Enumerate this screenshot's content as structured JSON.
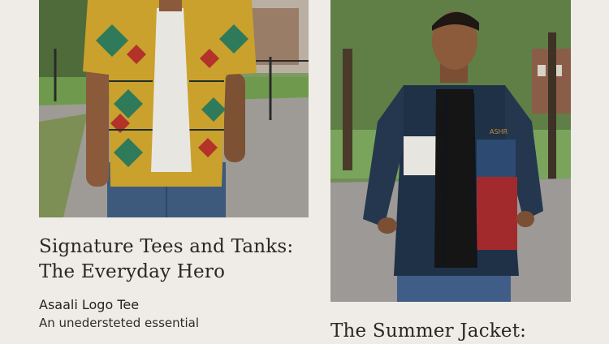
{
  "cards": [
    {
      "headline_line1": "Signature Tees and Tanks:",
      "headline_line2": "The Everyday Hero",
      "product_name": "Asaali Logo Tee",
      "product_desc": "An unedersteted essential",
      "image_alt": "Model wearing a colorful kente-pattern shirt over a white tee"
    },
    {
      "headline_line1": "The Summer Jacket:",
      "image_alt": "Model wearing a navy color-block zip jacket",
      "jacket_logo": "ASHR"
    }
  ]
}
